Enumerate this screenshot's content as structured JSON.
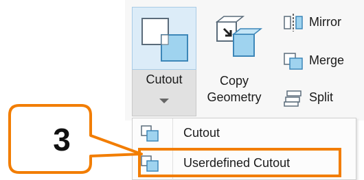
{
  "ribbon": {
    "cutout_label": "Cutout",
    "copy_geometry_line1": "Copy",
    "copy_geometry_line2": "Geometry",
    "mirror_label": "Mirror",
    "merge_label": "Merge",
    "split_label": "Split"
  },
  "dropdown_menu": {
    "items": [
      {
        "label": "Cutout",
        "icon": "cutout-icon"
      },
      {
        "label": "Userdefined Cutout",
        "icon": "userdefined-cutout-icon"
      }
    ]
  },
  "annotation": {
    "step_number": "3",
    "accent_color": "#f27d00"
  }
}
